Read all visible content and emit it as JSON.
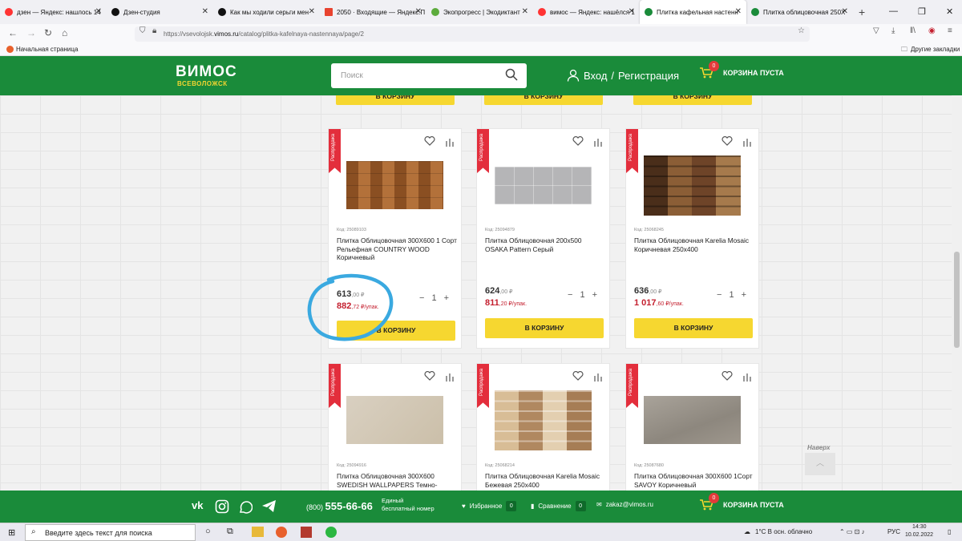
{
  "browser": {
    "tabs": [
      {
        "label": "дзен — Яндекс: нашлось 14",
        "color": "#f33"
      },
      {
        "label": "Дзен-студия",
        "color": "#111"
      },
      {
        "label": "Как мы ходили серьги мен",
        "color": "#111"
      },
      {
        "label": "2050 · Входящие — Яндекс.П",
        "color": "#e8432f"
      },
      {
        "label": "Экопрогресс | Экодиктант",
        "color": "#5cab3c"
      },
      {
        "label": "вимос — Яндекс: нашёлся 1",
        "color": "#f33"
      },
      {
        "label": "Плитка кафельная настенн",
        "color": "#1a8b3a"
      },
      {
        "label": "Плитка облицовочная 250Х",
        "color": "#1a8b3a"
      }
    ],
    "url_prefix": "https://vsevolojsk.",
    "url_domain": "vimos.ru",
    "url_path": "/catalog/plitka-kafelnaya-nastennaya/page/2",
    "bookmark_home": "Начальная страница",
    "bookmark_other": "Другие закладки"
  },
  "site": {
    "logo": "ВИМОС",
    "city": "ВСЕВОЛОЖСК",
    "search_placeholder": "Поиск",
    "login": "Вход",
    "separator": "/",
    "register": "Регистрация",
    "cart_count": "0",
    "cart_label": "КОРЗИНА ПУСТА",
    "top_button": "В КОРЗИНУ",
    "sale_ribbon": "Распродажа",
    "to_cart": "В КОРЗИНУ",
    "up_label": "Наверх"
  },
  "products": [
    {
      "code": "Код: 25089103",
      "name": "Плитка Облицовочная 300X600 1 Сорт Рельефная COUNTRY WOOD Коричневый",
      "price": "613",
      "price_dec": ",00 ₽",
      "pack": "882",
      "pack_dec": ",72 ₽/упак.",
      "qty": "1",
      "tile": "wood"
    },
    {
      "code": "Код: 25094879",
      "name": "Плитка Облицовочная 200x500 OSAKA Pattern Серый",
      "price": "624",
      "price_dec": ",00 ₽",
      "pack": "811",
      "pack_dec": ",20 ₽/упак.",
      "qty": "1",
      "tile": "grey"
    },
    {
      "code": "Код: 25068245",
      "name": "Плитка Облицовочная Karelia Mosaic Коричневая 250x400",
      "price": "636",
      "price_dec": ",00 ₽",
      "pack": "1 017",
      "pack_dec": ",60 ₽/упак.",
      "qty": "1",
      "tile": "brown"
    },
    {
      "code": "Код: 25094916",
      "name": "Плитка Облицовочная 300X600 SWEDISH WALLPAPERS Темно-",
      "tile": "beige"
    },
    {
      "code": "Код: 25068214",
      "name": "Плитка Облицовочная Karelia Mosaic Бежевая 250x400",
      "tile": "beigemosaic"
    },
    {
      "code": "Код: 25087680",
      "name": "Плитка Облицовочная 300X600 1Сорт SAVOY Коричневый",
      "tile": "stone"
    }
  ],
  "footer": {
    "phone_code": "(800)",
    "phone": "555-66-66",
    "phone_note1": "Единый",
    "phone_note2": "бесплатный номер",
    "favorites": "Избранное",
    "favorites_count": "0",
    "compare": "Сравнение",
    "compare_count": "0",
    "email": "zakaz@vimos.ru",
    "cart_count": "0",
    "cart_label": "КОРЗИНА ПУСТА"
  },
  "taskbar": {
    "search_placeholder": "Введите здесь текст для поиска",
    "weather": "1°C  В осн. облачно",
    "lang": "РУС",
    "time": "14:30",
    "date": "10.02.2022"
  },
  "annotation": {
    "color": "#3aa9e0"
  }
}
